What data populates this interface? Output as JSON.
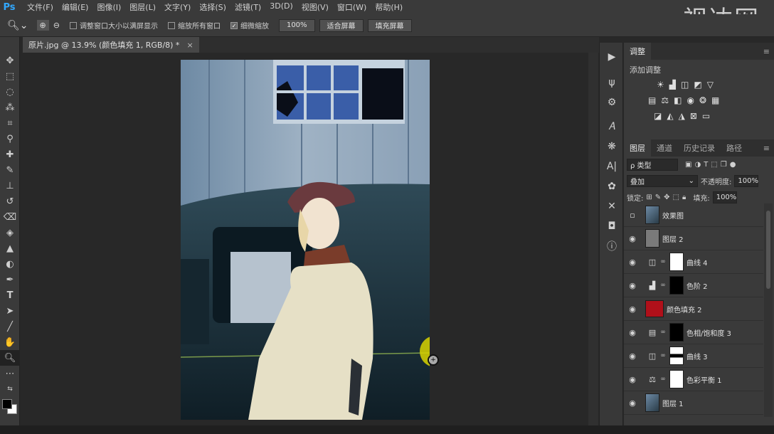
{
  "app_logo": "Ps",
  "menu": [
    "文件(F)",
    "编辑(E)",
    "图像(I)",
    "图层(L)",
    "文字(Y)",
    "选择(S)",
    "滤镜(T)",
    "3D(D)",
    "视图(V)",
    "窗口(W)",
    "帮助(H)"
  ],
  "options": {
    "resize_windows_label": "调整窗口大小以满屏显示",
    "zoom_all_windows_label": "缩放所有窗口",
    "scrubby_zoom_label": "细微缩放",
    "zoom_percent": "100%",
    "fit_screen": "适合屏幕",
    "fill_screen": "填充屏幕"
  },
  "watermark": "视达网",
  "document_tab": {
    "title": "原片.jpg @ 13.9% (颜色填充 1, RGB/8) *",
    "close": "×"
  },
  "panels": {
    "adjustments_tab": "调整",
    "adjustments_add_label": "添加调整",
    "layers_tabs": [
      "图层",
      "通道",
      "历史记录",
      "路径"
    ],
    "filter_kind": "ρ 类型",
    "blend_mode": "叠加",
    "opacity_label": "不透明度:",
    "opacity_value": "100%",
    "lock_label": "锁定:",
    "fill_label": "填充:",
    "fill_value": "100%"
  },
  "layers": [
    {
      "name": "效果图",
      "visible": false,
      "kind": "image"
    },
    {
      "name": "图层 2",
      "visible": true,
      "kind": "gray"
    },
    {
      "name": "曲线 4",
      "visible": true,
      "kind": "adj-white",
      "icon": "curves-icon"
    },
    {
      "name": "色阶 2",
      "visible": true,
      "kind": "adj-black",
      "icon": "levels-icon"
    },
    {
      "name": "颜色填充 2",
      "visible": true,
      "kind": "fill-red"
    },
    {
      "name": "色相/饱和度 3",
      "visible": true,
      "kind": "adj-black",
      "icon": "hue-sat-icon"
    },
    {
      "name": "曲线 3",
      "visible": true,
      "kind": "adj-mask",
      "icon": "curves-icon"
    },
    {
      "name": "色彩平衡 1",
      "visible": true,
      "kind": "adj-white",
      "icon": "color-balance-icon"
    },
    {
      "name": "图层 1",
      "visible": true,
      "kind": "image"
    }
  ],
  "colors": {
    "accent": "#31a8ff",
    "fill_red": "#b0101a",
    "cursor_ring": "#d8d400"
  }
}
